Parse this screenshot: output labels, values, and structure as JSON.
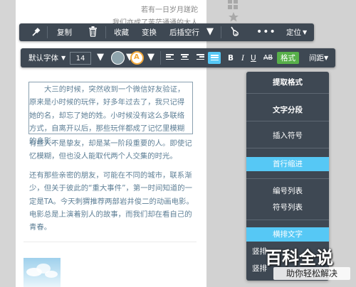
{
  "page_text": {
    "top_line_1": "若有一日岁月蹉跎",
    "top_line_2": "我们亦成了苦茫通通的大人",
    "selected_paragraph": "大三的时候，突然收到一个微信好友验证，原来是小时候的玩伴，好多年过去了，我只记得她的名，却忘了她的姓。小时候没有这么多联络方式，自离开以后，那些玩伴都成了记忆里模糊的身影。",
    "paragraph_2": "有些人不是挚友，却是某一阶段重要的人。即使记忆模糊，但也没人能取代两个人交集的时光。",
    "paragraph_3": "还有那些亲密的朋友，可能在不同的城市，联系渐少，但关于彼此的“重大事件”，第一时间知道的一定是TA。今天刺猬推荐两部岩井俊二的动画电影。电影总是上演着别人的故事，而我们却在看自己的青春。"
  },
  "action_toolbar": {
    "items": [
      {
        "name": "pin",
        "icon": "pin-icon"
      },
      {
        "name": "copy",
        "label": "复制"
      },
      {
        "name": "delete",
        "icon": "trash-icon"
      },
      {
        "name": "collect",
        "label": "收藏"
      },
      {
        "name": "transform",
        "label": "变换"
      },
      {
        "name": "blank-line",
        "label": "后插空行"
      },
      {
        "name": "format-painter",
        "icon": "format-painter-icon"
      },
      {
        "name": "more",
        "icon": "more-dots-icon"
      },
      {
        "name": "position",
        "label": "定位"
      }
    ]
  },
  "format_toolbar": {
    "font_family": "默认字体",
    "font_size": "14",
    "bold": "B",
    "italic": "I",
    "underline": "U",
    "strikethrough": "AB",
    "format_label": "格式",
    "spacing_label": "间距",
    "text_color": "#8fa5ad",
    "bg_color": "#f2a93b"
  },
  "side_menu": {
    "items": [
      {
        "label": "提取格式",
        "style": "bold"
      },
      {
        "label": "文字分段",
        "style": "bold"
      },
      {
        "label": "插入符号",
        "style": "normal"
      },
      {
        "label": "首行缩进",
        "style": "highlight"
      },
      {
        "label": "编号列表",
        "style": "normal"
      },
      {
        "label": "符号列表",
        "style": "normal"
      },
      {
        "label": "横排文字",
        "style": "highlight"
      },
      {
        "label": "竖排",
        "style": "normal"
      },
      {
        "label": "竖排",
        "style": "normal"
      }
    ]
  },
  "watermark": {
    "title": "百科全说",
    "subtitle": "助你轻松解决"
  },
  "colors": {
    "toolbar_bg": "#3e4853",
    "accent_blue": "#56c8f5",
    "accent_green": "#58b04a",
    "text_blue_gray": "#5e7f96"
  }
}
